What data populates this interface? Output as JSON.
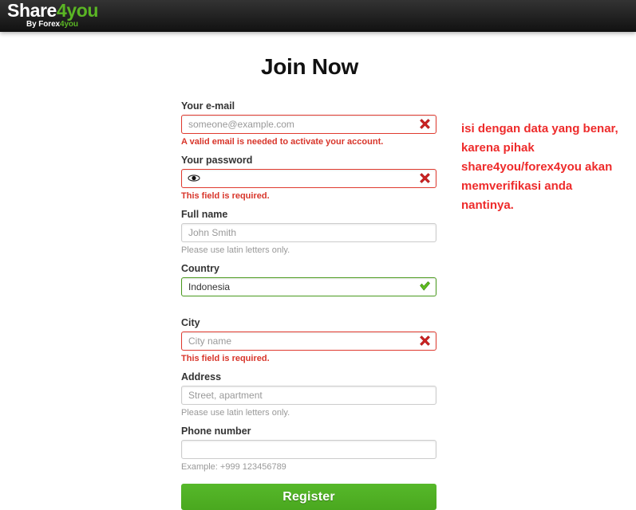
{
  "header": {
    "logo": {
      "main_prefix": "Share",
      "main_accent": "4you",
      "sub_prefix": "By Forex",
      "sub_accent": "4you"
    }
  },
  "main": {
    "title": "Join Now",
    "fields": [
      {
        "label": "Your e-mail",
        "value": "",
        "placeholder": "someone@example.com",
        "message": "A valid email is needed to activate your account.",
        "message_type": "error",
        "state": "error",
        "status_icon": "error-x-icon"
      },
      {
        "label": "Your password",
        "value": "",
        "placeholder": "",
        "message": "This field is required.",
        "message_type": "error",
        "state": "error",
        "status_icon": "error-x-icon",
        "left_icon": "eye-icon"
      },
      {
        "label": "Full name",
        "value": "",
        "placeholder": "John Smith",
        "message": "Please use latin letters only.",
        "message_type": "hint",
        "state": "normal",
        "status_icon": ""
      },
      {
        "label": "Country",
        "value": "Indonesia",
        "placeholder": "",
        "message": "",
        "message_type": "none",
        "state": "valid",
        "status_icon": "valid-check-icon"
      },
      {
        "label": "City",
        "value": "",
        "placeholder": "City name",
        "message": "This field is required.",
        "message_type": "error",
        "state": "error",
        "status_icon": "error-x-icon"
      },
      {
        "label": "Address",
        "value": "",
        "placeholder": "Street, apartment",
        "message": "Please use latin letters only.",
        "message_type": "hint",
        "state": "normal",
        "status_icon": ""
      },
      {
        "label": "Phone number",
        "value": "",
        "placeholder": "",
        "message": "Example: +999 123456789",
        "message_type": "hint",
        "state": "normal",
        "status_icon": ""
      }
    ],
    "submit_label": "Register"
  },
  "annotation": {
    "text": "isi dengan data yang benar, karena pihak share4you/forex4you akan memverifikasi anda nantinya.",
    "color": "#ee2b2b"
  },
  "colors": {
    "brand_green": "#5ab524",
    "button_green": "#4bae22",
    "error_red": "#d8352a",
    "valid_green": "#4a9a1e",
    "header_black": "#1a1a1a"
  }
}
